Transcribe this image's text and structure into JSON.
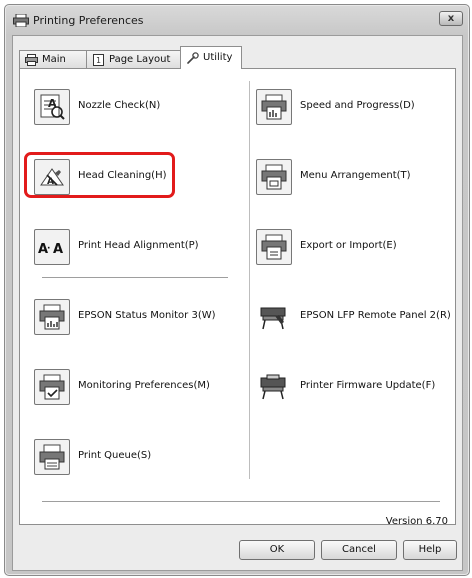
{
  "window": {
    "title": "Printing Preferences",
    "close_label": "x"
  },
  "tabs": [
    {
      "label": "Main",
      "icon": "printer-icon"
    },
    {
      "label": "Page Layout",
      "icon": "page-layout-icon"
    },
    {
      "label": "Utility",
      "icon": "wrench-icon",
      "active": true
    }
  ],
  "left_items": [
    {
      "label": "Nozzle Check(N)",
      "icon": "nozzle-check-icon"
    },
    {
      "label": "Head Cleaning(H)",
      "icon": "head-cleaning-icon",
      "highlighted": true
    },
    {
      "label": "Print Head Alignment(P)",
      "icon": "head-alignment-icon"
    },
    {
      "label": "EPSON Status Monitor 3(W)",
      "icon": "status-monitor-icon"
    },
    {
      "label": "Monitoring Preferences(M)",
      "icon": "monitoring-preferences-icon"
    },
    {
      "label": "Print Queue(S)",
      "icon": "print-queue-icon"
    }
  ],
  "right_items": [
    {
      "label": "Speed and Progress(D)",
      "icon": "speed-progress-icon"
    },
    {
      "label": "Menu Arrangement(T)",
      "icon": "menu-arrangement-icon"
    },
    {
      "label": "Export or Import(E)",
      "icon": "export-import-icon"
    },
    {
      "label": "EPSON LFP Remote Panel 2(R)",
      "icon": "remote-panel-icon"
    },
    {
      "label": "Printer Firmware Update(F)",
      "icon": "firmware-update-icon"
    }
  ],
  "version": "Version 6.70",
  "buttons": {
    "ok": "OK",
    "cancel": "Cancel",
    "help": "Help"
  },
  "colors": {
    "highlight": "#e21b1b"
  }
}
